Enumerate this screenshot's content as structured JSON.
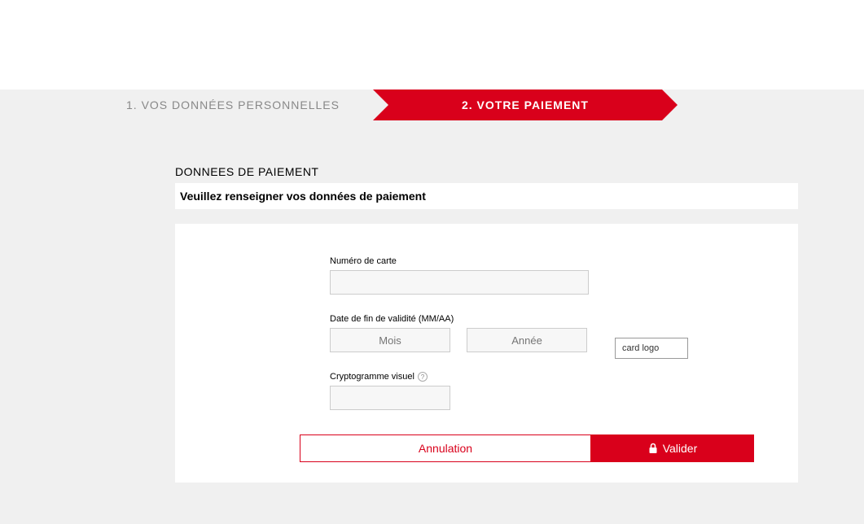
{
  "stepper": {
    "step1": "1. VOS DONNÉES PERSONNELLES",
    "step2": "2. VOTRE PAIEMENT"
  },
  "section": {
    "title": "DONNEES DE PAIEMENT",
    "subtitle": "Veuillez renseigner vos données de paiement"
  },
  "form": {
    "card_number_label": "Numéro de carte",
    "card_number_value": "",
    "expiry_label": "Date de fin de validité (MM/AA)",
    "month_placeholder": "Mois",
    "year_placeholder": "Année",
    "cvv_label": "Cryptogramme visuel",
    "cvv_value": ""
  },
  "card_logo": "card logo",
  "buttons": {
    "cancel": "Annulation",
    "submit": "Valider"
  },
  "colors": {
    "accent": "#d9001b",
    "page_bg": "#f0f0f0"
  }
}
